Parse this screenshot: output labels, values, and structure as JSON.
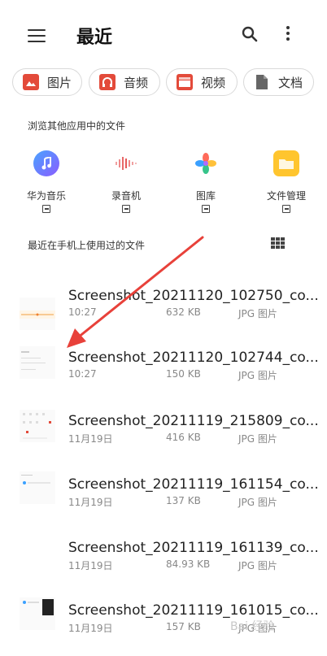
{
  "header": {
    "title": "最近"
  },
  "chips": [
    {
      "label": "图片",
      "icon": "image-icon",
      "color": "#e34a3a"
    },
    {
      "label": "音频",
      "icon": "headphone-icon",
      "color": "#e34a3a"
    },
    {
      "label": "视频",
      "icon": "clapperboard-icon",
      "color": "#e34a3a"
    },
    {
      "label": "文档",
      "icon": "document-icon",
      "color": "#666666"
    }
  ],
  "browse_section": {
    "label": "浏览其他应用中的文件"
  },
  "apps": [
    {
      "name": "华为音乐",
      "icon": "music-icon"
    },
    {
      "name": "录音机",
      "icon": "waveform-icon"
    },
    {
      "name": "图库",
      "icon": "gallery-icon"
    },
    {
      "name": "文件管理",
      "icon": "folder-icon"
    }
  ],
  "recent_section": {
    "label": "最近在手机上使用过的文件"
  },
  "files": [
    {
      "name": "Screenshot_20211120_102750_co...",
      "time": "10:27",
      "size": "632 KB",
      "type": "JPG 图片"
    },
    {
      "name": "Screenshot_20211120_102744_co...",
      "time": "10:27",
      "size": "150 KB",
      "type": "JPG 图片"
    },
    {
      "name": "Screenshot_20211119_215809_co...",
      "time": "11月19日",
      "size": "416 KB",
      "type": "JPG 图片"
    },
    {
      "name": "Screenshot_20211119_161154_co...",
      "time": "11月19日",
      "size": "137 KB",
      "type": "JPG 图片"
    },
    {
      "name": "Screenshot_20211119_161139_co...",
      "time": "11月19日",
      "size": "84.93 KB",
      "type": "JPG 图片"
    },
    {
      "name": "Screenshot_20211119_161015_co...",
      "time": "11月19日",
      "size": "157 KB",
      "type": "JPG 图片"
    }
  ],
  "watermark": "Bai 经验",
  "colors": {
    "accent": "#e34a3a",
    "arrow": "#e8413a"
  }
}
